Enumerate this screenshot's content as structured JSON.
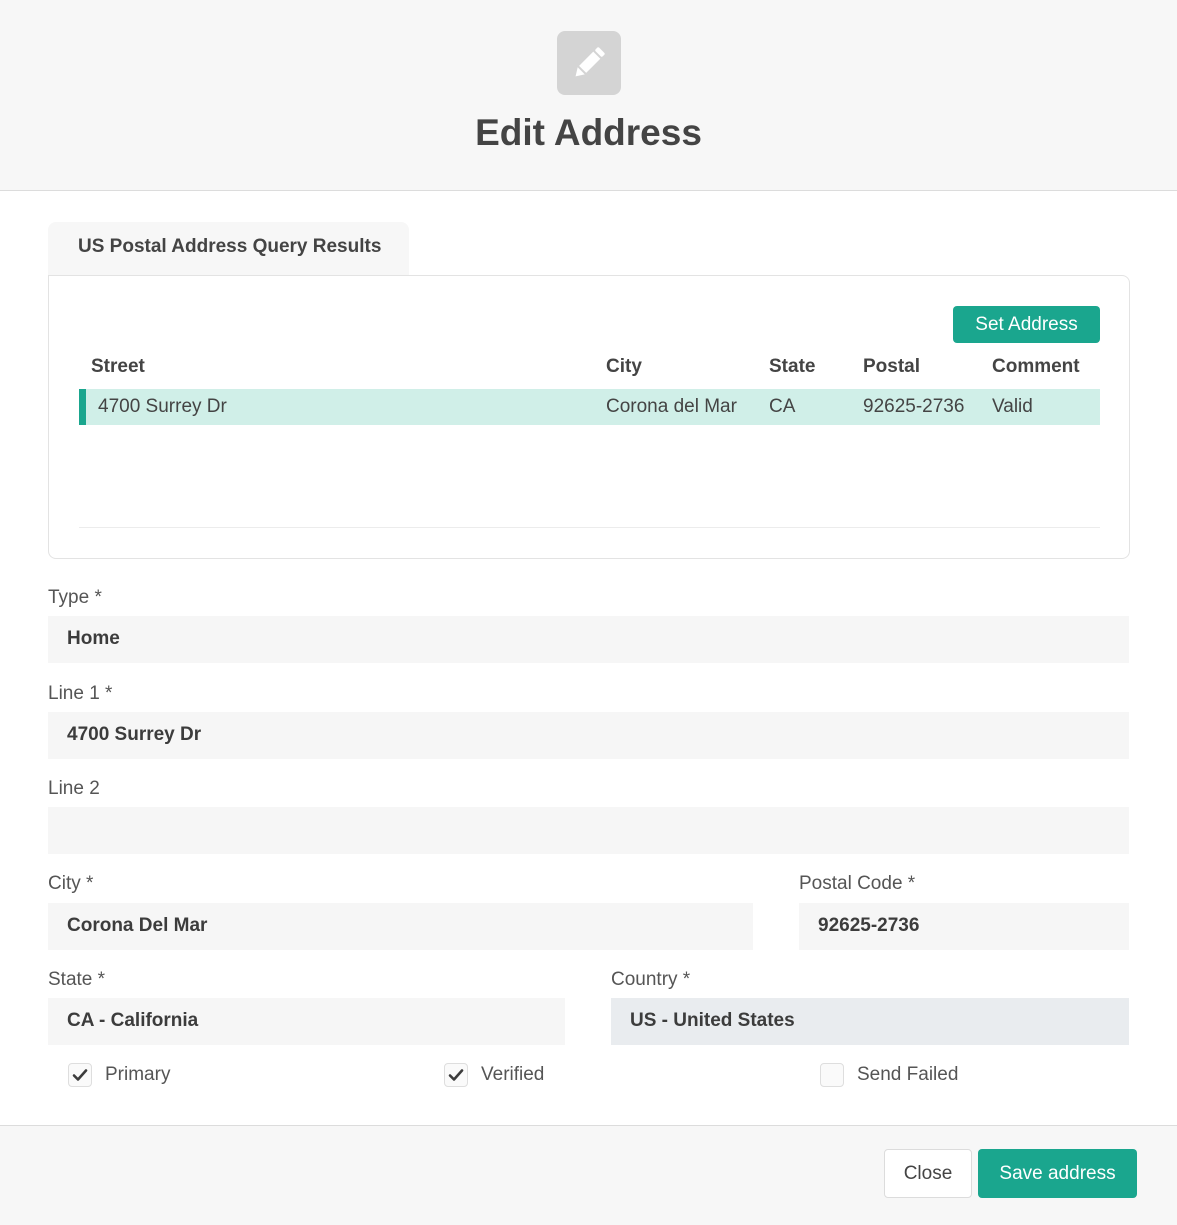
{
  "header": {
    "title": "Edit Address",
    "icon": "pencil-icon"
  },
  "results": {
    "tab_label": "US Postal Address Query Results",
    "set_address_label": "Set Address",
    "columns": {
      "street": "Street",
      "city": "City",
      "state": "State",
      "postal": "Postal",
      "comment": "Comment"
    },
    "rows": [
      {
        "street": "4700 Surrey Dr",
        "city": "Corona del Mar",
        "state": "CA",
        "postal": "92625-2736",
        "comment": "Valid"
      }
    ]
  },
  "form": {
    "type": {
      "label": "Type *",
      "value": "Home"
    },
    "line1": {
      "label": "Line 1 *",
      "value": "4700 Surrey Dr"
    },
    "line2": {
      "label": "Line 2",
      "value": ""
    },
    "city": {
      "label": "City *",
      "value": "Corona Del Mar"
    },
    "postal_code": {
      "label": "Postal Code *",
      "value": "92625-2736"
    },
    "state": {
      "label": "State *",
      "value": "CA - California"
    },
    "country": {
      "label": "Country *",
      "value": "US - United States"
    },
    "primary": {
      "label": "Primary",
      "checked": true
    },
    "verified": {
      "label": "Verified",
      "checked": true
    },
    "send_failed": {
      "label": "Send Failed",
      "checked": false
    }
  },
  "footer": {
    "close_label": "Close",
    "save_label": "Save address"
  },
  "colors": {
    "accent": "#1aa68e",
    "selected_row": "#d0efe8",
    "header_bg": "#f7f7f7"
  }
}
